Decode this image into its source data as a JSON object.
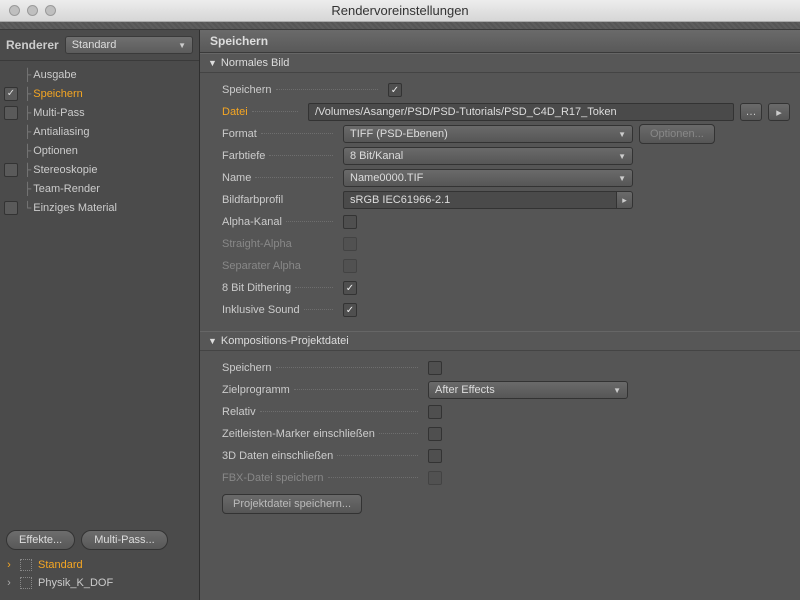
{
  "window": {
    "title": "Rendervoreinstellungen"
  },
  "renderer": {
    "label": "Renderer",
    "value": "Standard"
  },
  "sidebar": {
    "items": [
      {
        "label": "Ausgabe",
        "cb": "hidden"
      },
      {
        "label": "Speichern",
        "cb": "checked",
        "sel": true
      },
      {
        "label": "Multi-Pass",
        "cb": "unchecked"
      },
      {
        "label": "Antialiasing",
        "cb": "hidden"
      },
      {
        "label": "Optionen",
        "cb": "hidden"
      },
      {
        "label": "Stereoskopie",
        "cb": "unchecked"
      },
      {
        "label": "Team-Render",
        "cb": "hidden"
      },
      {
        "label": "Einziges Material",
        "cb": "unchecked"
      }
    ],
    "buttons": {
      "effects": "Effekte...",
      "multipass": "Multi-Pass..."
    },
    "presets": [
      {
        "label": "Standard",
        "sel": true
      },
      {
        "label": "Physik_K_DOF",
        "sel": false
      }
    ]
  },
  "panel": {
    "title": "Speichern",
    "section1": {
      "title": "Normales Bild",
      "rows": {
        "speichern": "Speichern",
        "datei": "Datei",
        "datei_value": "/Volumes/Asanger/PSD/PSD-Tutorials/PSD_C4D_R17_Token",
        "format": "Format",
        "format_value": "TIFF (PSD-Ebenen)",
        "optionen_btn": "Optionen...",
        "farbtiefe": "Farbtiefe",
        "farbtiefe_value": "8 Bit/Kanal",
        "name": "Name",
        "name_value": "Name0000.TIF",
        "bildfarbprofil": "Bildfarbprofil",
        "bildfarbprofil_value": "sRGB IEC61966-2.1",
        "alpha": "Alpha-Kanal",
        "straight": "Straight-Alpha",
        "separater": "Separater Alpha",
        "dither": "8 Bit Dithering",
        "sound": "Inklusive Sound"
      }
    },
    "section2": {
      "title": "Kompositions-Projektdatei",
      "rows": {
        "speichern": "Speichern",
        "ziel": "Zielprogramm",
        "ziel_value": "After Effects",
        "relativ": "Relativ",
        "marker": "Zeitleisten-Marker einschließen",
        "d3": "3D Daten einschließen",
        "fbx": "FBX-Datei speichern",
        "save_btn": "Projektdatei speichern..."
      }
    }
  }
}
